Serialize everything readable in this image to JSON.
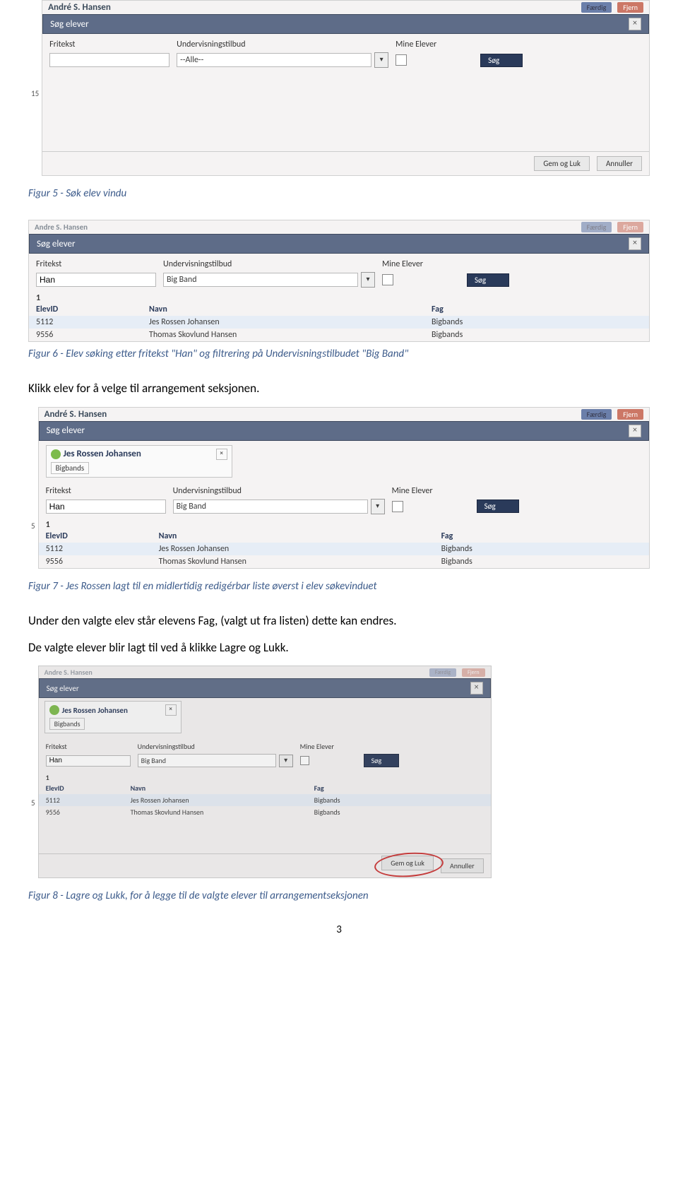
{
  "top_name": "André S. Hansen",
  "badge_done": "Færdig",
  "badge_remove": "Fjern",
  "dialog_title": "Søg elever",
  "filter_labels": {
    "fritekst": "Fritekst",
    "tilbud": "Undervisningstilbud",
    "mine": "Mine Elever"
  },
  "fig5": {
    "fritekst_value": "",
    "tilbud_value": "--Alle--",
    "sog": "Søg",
    "gem": "Gem og Luk",
    "annuller": "Annuller",
    "sidebar": "15"
  },
  "fig6": {
    "fritekst_value": "Han",
    "tilbud_value": "Big Band",
    "sog": "Søg",
    "count": "1",
    "headers": {
      "id": "ElevID",
      "navn": "Navn",
      "fag": "Fag"
    },
    "rows": [
      {
        "id": "5112",
        "navn": "Jes Rossen Johansen",
        "fag": "Bigbands"
      },
      {
        "id": "9556",
        "navn": "Thomas Skovlund Hansen",
        "fag": "Bigbands"
      }
    ]
  },
  "fig7": {
    "top_name": "André S. Hansen",
    "sidebar": "5",
    "selected_name": "Jes Rossen Johansen",
    "selected_sub": "Bigbands",
    "fritekst_value": "Han",
    "tilbud_value": "Big Band",
    "sog": "Søg",
    "count": "1",
    "headers": {
      "id": "ElevID",
      "navn": "Navn",
      "fag": "Fag"
    },
    "rows": [
      {
        "id": "5112",
        "navn": "Jes Rossen Johansen",
        "fag": "Bigbands"
      },
      {
        "id": "9556",
        "navn": "Thomas Skovlund Hansen",
        "fag": "Bigbands"
      }
    ]
  },
  "fig8": {
    "sidebar": "5",
    "selected_name": "Jes Rossen Johansen",
    "selected_sub": "Bigbands",
    "fritekst_value": "Han",
    "tilbud_value": "Big Band",
    "sog": "Søg",
    "count": "1",
    "headers": {
      "id": "ElevID",
      "navn": "Navn",
      "fag": "Fag"
    },
    "rows": [
      {
        "id": "5112",
        "navn": "Jes Rossen Johansen",
        "fag": "Bigbands"
      },
      {
        "id": "9556",
        "navn": "Thomas Skovlund Hansen",
        "fag": "Bigbands"
      }
    ],
    "gem": "Gem og Luk",
    "annuller": "Annuller"
  },
  "captions": {
    "f5": "Figur 5 - Søk elev vindu",
    "f6": "Figur 6 - Elev søking etter fritekst \"Han\" og filtrering på Undervisningstilbudet \"Big Band\"",
    "f7": "Figur 7 - Jes Rossen lagt til en midlertidig redigérbar liste øverst i elev søkevinduet",
    "f8": "Figur 8 - Lagre og Lukk, for å legge til de valgte elever til arrangementseksjonen"
  },
  "body": {
    "p1": "Klikk elev for å velge til arrangement seksjonen.",
    "p2": "Under den valgte elev står elevens Fag, (valgt ut fra listen) dette kan endres.",
    "p3": "De valgte elever blir lagt til ved å klikke Lagre og Lukk."
  },
  "page_number": "3"
}
